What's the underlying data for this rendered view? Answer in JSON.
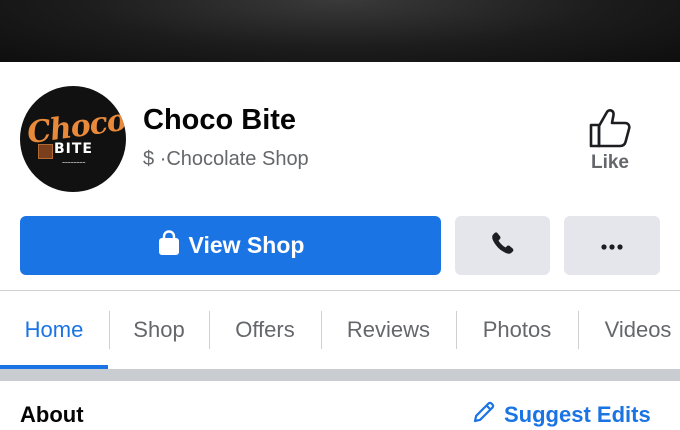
{
  "page": {
    "name": "Choco Bite",
    "price_symbol": "$",
    "separator": "·",
    "category": "Chocolate Shop"
  },
  "logo": {
    "word": "Choco",
    "sub": "BITE"
  },
  "like": {
    "label": "Like"
  },
  "actions": {
    "view_shop": "View Shop",
    "call_icon": "phone-icon",
    "more_icon": "more-icon"
  },
  "tabs": [
    {
      "label": "Home",
      "active": true
    },
    {
      "label": "Shop"
    },
    {
      "label": "Offers"
    },
    {
      "label": "Reviews"
    },
    {
      "label": "Photos"
    },
    {
      "label": "Videos"
    }
  ],
  "about": {
    "title": "About",
    "suggest_label": "Suggest Edits"
  },
  "colors": {
    "accent": "#1b74e4",
    "secondary_text": "#65676b",
    "button_gray": "#e4e6eb"
  }
}
